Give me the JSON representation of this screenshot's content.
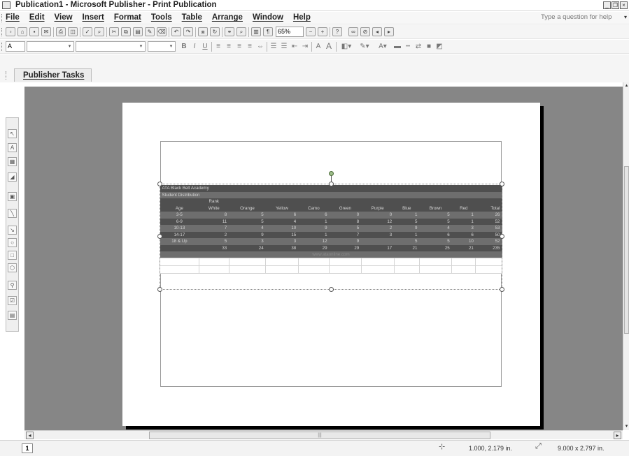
{
  "window": {
    "title": "Publication1 - Microsoft Publisher - Print Publication"
  },
  "menu": {
    "items": [
      "File",
      "Edit",
      "View",
      "Insert",
      "Format",
      "Tools",
      "Table",
      "Arrange",
      "Window",
      "Help"
    ],
    "help_placeholder": "Type a question for help"
  },
  "standard_toolbar": {
    "zoom": "65%"
  },
  "formatting_toolbar": {
    "style_value": "A",
    "font_value": "",
    "size_value": ""
  },
  "task_pane": {
    "tab_label": "Publisher Tasks"
  },
  "table": {
    "title": "ATA Black Belt Academy",
    "subtitle": "Student Distribution",
    "rank_label": "Rank",
    "headers": [
      "Age",
      "White",
      "Orange",
      "Yellow",
      "Camo",
      "Green",
      "Purple",
      "Blue",
      "Brown",
      "Red",
      "Total"
    ],
    "rows": [
      [
        "3-5",
        "8",
        "5",
        "6",
        "6",
        "0",
        "0",
        "1",
        "5",
        "1",
        "26"
      ],
      [
        "6-9",
        "11",
        "5",
        "4",
        "1",
        "8",
        "12",
        "5",
        "5",
        "1",
        "52"
      ],
      [
        "10-13",
        "7",
        "4",
        "10",
        "9",
        "5",
        "2",
        "9",
        "4",
        "3",
        "53"
      ],
      [
        "14-17",
        "2",
        "9",
        "15",
        "1",
        "7",
        "3",
        "1",
        "6",
        "6",
        "50"
      ],
      [
        "18 & Up",
        "5",
        "3",
        "3",
        "12",
        "9",
        "",
        "5",
        "5",
        "10",
        "52"
      ]
    ],
    "totals": [
      "",
      "33",
      "24",
      "38",
      "29",
      "29",
      "17",
      "21",
      "25",
      "21",
      "235"
    ],
    "footer": "www.ataonline.com"
  },
  "status": {
    "page_number": "1",
    "position": "1.000, 2.179 in.",
    "size": "9.000 x 2.797 in."
  }
}
